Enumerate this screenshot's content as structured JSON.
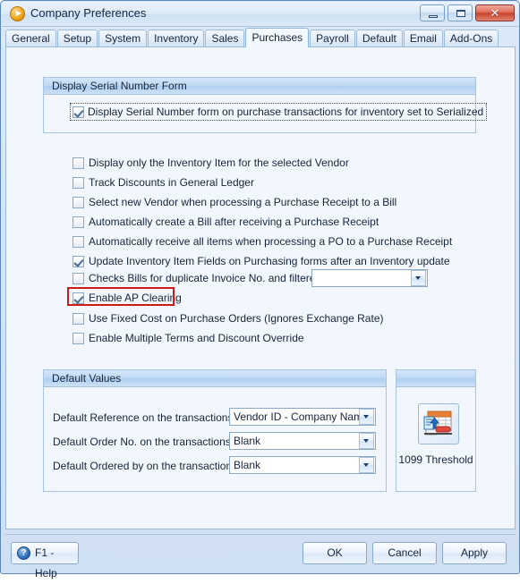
{
  "window": {
    "title": "Company Preferences",
    "icon": "app-play-icon",
    "buttons": {
      "minimize": "minimize-icon",
      "maximize": "maximize-icon",
      "close": "✕"
    }
  },
  "tabs": [
    {
      "label": "General",
      "active": false
    },
    {
      "label": "Setup",
      "active": false
    },
    {
      "label": "System",
      "active": false
    },
    {
      "label": "Inventory",
      "active": false
    },
    {
      "label": "Sales",
      "active": false
    },
    {
      "label": "Purchases",
      "active": true
    },
    {
      "label": "Payroll",
      "active": false
    },
    {
      "label": "Default",
      "active": false
    },
    {
      "label": "Email",
      "active": false
    },
    {
      "label": "Add-Ons",
      "active": false
    }
  ],
  "serial_group": {
    "header": "Display Serial Number Form",
    "checkbox": {
      "label": "Display Serial Number form on purchase transactions for inventory set to Serialized",
      "checked": true,
      "focused": true
    }
  },
  "options": [
    {
      "label": "Display only the Inventory Item for the selected Vendor",
      "checked": false
    },
    {
      "label": "Track Discounts in General Ledger",
      "checked": false
    },
    {
      "label": "Select new Vendor when processing a Purchase Receipt to a Bill",
      "checked": false
    },
    {
      "label": "Automatically create a Bill after receiving a Purchase Receipt",
      "checked": false
    },
    {
      "label": "Automatically receive all items when processing a PO to a Purchase Receipt",
      "checked": false
    },
    {
      "label": "Update Inventory Item Fields on Purchasing forms after an Inventory update",
      "checked": true
    },
    {
      "label": "Checks Bills for duplicate Invoice No. and filtered by:",
      "checked": false
    },
    {
      "label": "Enable AP Clearing",
      "checked": true
    },
    {
      "label": "Use Fixed Cost on Purchase Orders (Ignores Exchange Rate)",
      "checked": false
    },
    {
      "label": "Enable Multiple Terms and Discount Override",
      "checked": false
    }
  ],
  "duplicate_filter_combo": {
    "value": "",
    "placeholder": ""
  },
  "highlight": {
    "target": "Enable AP Clearing",
    "color": "#d01a1a"
  },
  "defaults_group": {
    "header": "Default Values",
    "rows": [
      {
        "label": "Default Reference on the transactions",
        "value": "Vendor ID - Company Name"
      },
      {
        "label": "Default Order No. on the transactions",
        "value": "Blank"
      },
      {
        "label": "Default Ordered by on the transactions",
        "value": "Blank"
      }
    ]
  },
  "threshold_group": {
    "header": "",
    "button_icon": "1099-document-icon",
    "caption": "1099 Threshold"
  },
  "footer": {
    "help_label": "F1 - Help",
    "help_icon": "?",
    "ok_label": "OK",
    "cancel_label": "Cancel",
    "apply_label": "Apply"
  },
  "colors": {
    "accent": "#1f3e66",
    "panel_bg": "#f2f7fd",
    "window_bg": "#d3e3f4",
    "border": "#9cbada",
    "highlight": "#d01a1a",
    "close_button": "#c8432d"
  }
}
